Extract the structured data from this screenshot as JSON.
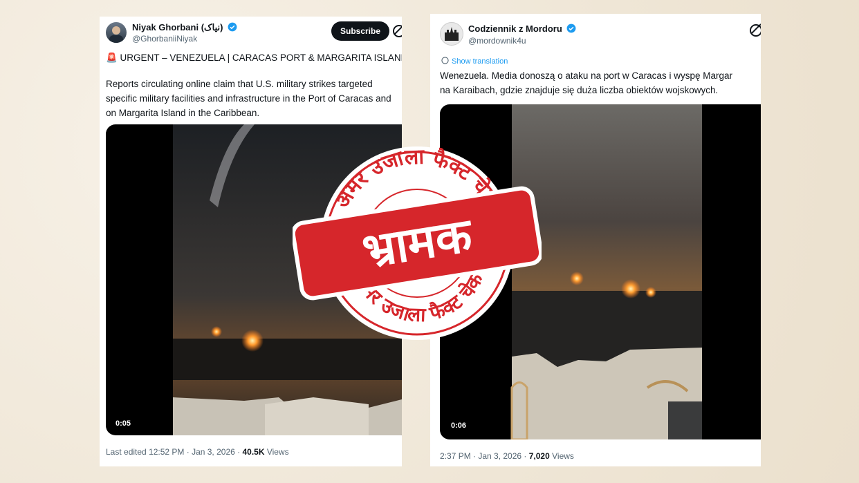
{
  "tweet1": {
    "name": "Niyak Ghorbani (نیاک)",
    "handle": "@GhorbaniiNiyak",
    "subscribe_label": "Subscribe",
    "headline": "🚨 URGENT – VENEZUELA | CARACAS PORT & MARGARITA ISLAND",
    "body_lines": [
      "Reports circulating online claim that U.S. military strikes targeted",
      "specific military facilities and infrastructure in the Port of Caracas and",
      "on Margarita Island in the Caribbean."
    ],
    "video_time": "0:05",
    "meta_prefix": "Last edited 12:52 PM · Jan 3, 2026 · ",
    "views_count": "40.5K",
    "views_label": " Views"
  },
  "tweet2": {
    "name": "Codziennik z Mordoru",
    "handle": "@mordownik4u",
    "translate_label": "Show translation",
    "body_lines": [
      "Wenezuela. Media donoszą o ataku na port w Caracas i wyspę Margar",
      "na Karaibach, gdzie znajduje się duża liczba obiektów wojskowych."
    ],
    "video_time": "0:06",
    "meta_prefix": "2:37 PM · Jan 3, 2026 · ",
    "views_count": "7,020",
    "views_label": " Views"
  },
  "stamp": {
    "top_arc": "अमर उजाला फैक्ट चेक",
    "bottom_arc": "अमर उजाला फैक्ट चेक",
    "verdict": "भ्रामक",
    "colors": {
      "red": "#d6262b",
      "white": "#ffffff"
    }
  },
  "icons": {
    "verified": "verified-badge-icon",
    "grok": "grok-icon",
    "translate": "translate-globe-icon"
  }
}
